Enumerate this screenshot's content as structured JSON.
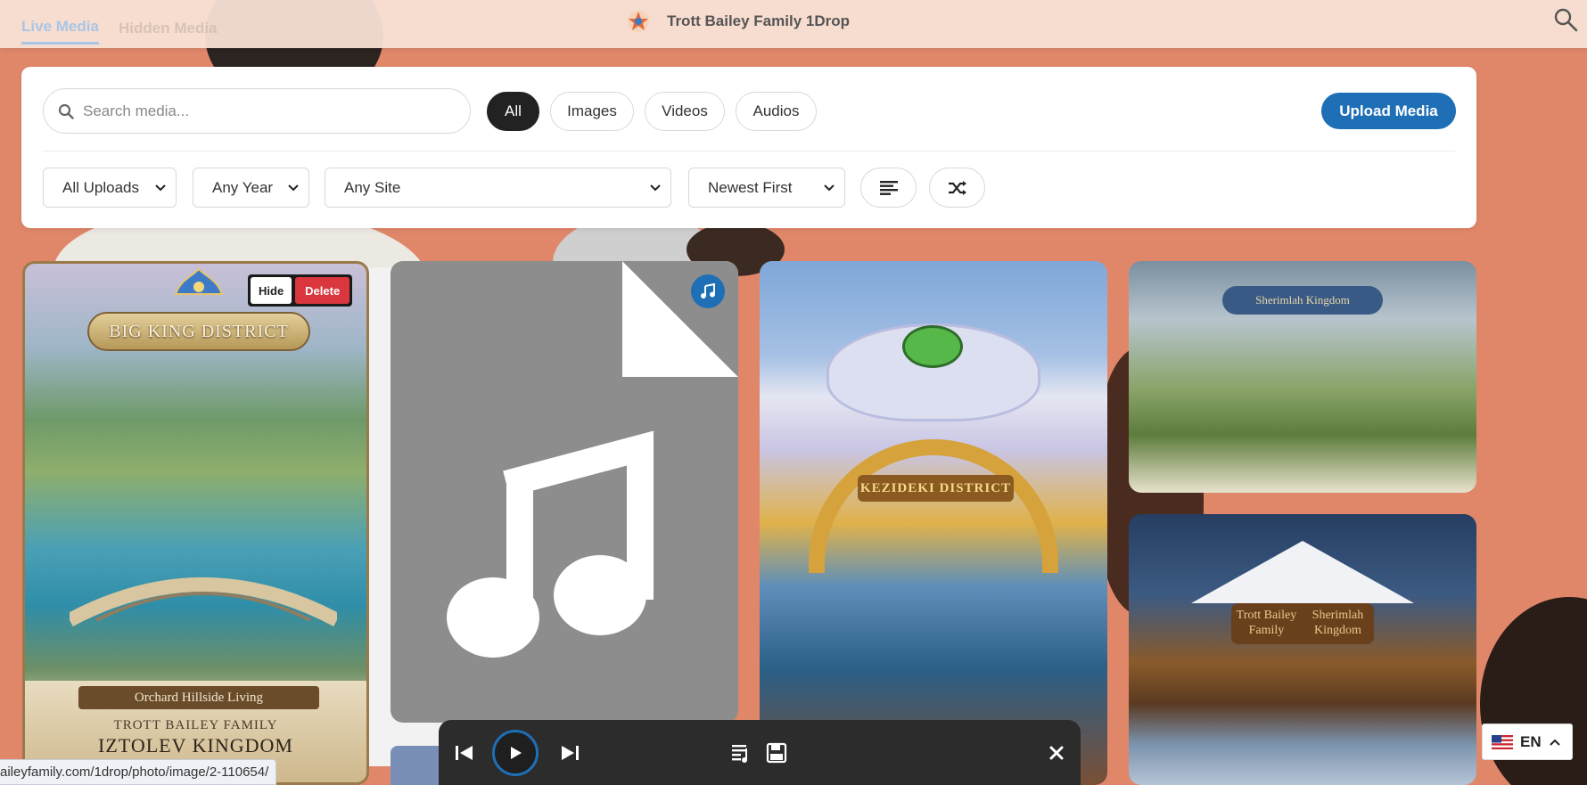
{
  "header": {
    "tabs": [
      {
        "label": "Live Media",
        "active": true
      },
      {
        "label": "Hidden Media",
        "active": false
      }
    ],
    "title": "Trott Bailey Family 1Drop"
  },
  "filters": {
    "search_placeholder": "Search media...",
    "type_chips": [
      {
        "label": "All",
        "active": true
      },
      {
        "label": "Images",
        "active": false
      },
      {
        "label": "Videos",
        "active": false
      },
      {
        "label": "Audios",
        "active": false
      }
    ],
    "upload_label": "Upload Media",
    "uploader_select": "All Uploads",
    "year_select": "Any Year",
    "site_select": "Any Site",
    "sort_select": "Newest First"
  },
  "cards": [
    {
      "type": "image",
      "banner": "BIG KING DISTRICT",
      "caption_top": "Orchard Hillside Living",
      "caption_family": "TROTT BAILEY FAMILY",
      "caption_kingdom": "IZTOLEV KINGDOM",
      "hide_label": "Hide",
      "delete_label": "Delete"
    },
    {
      "type": "audio",
      "badge_icon": "music-note-icon"
    },
    {
      "type": "image",
      "sign": "KEZIDEKI DISTRICT"
    },
    {
      "type": "image",
      "sign": "Sherimlah Kingdom"
    },
    {
      "type": "image",
      "sign_line1": "Trott Bailey Family",
      "sign_line2": "Sherimlah Kingdom"
    }
  ],
  "player": {
    "controls": [
      "previous-icon",
      "play-icon",
      "next-icon",
      "playlist-icon",
      "save-icon",
      "close-icon"
    ]
  },
  "status_url": "aileyfamily.com/1drop/photo/image/2-110654/",
  "language": {
    "code": "EN"
  },
  "colors": {
    "accent": "#1e6fb6",
    "delete": "#d9363e",
    "page_bg": "#e0876a",
    "topbar_bg": "#f8e2d6"
  }
}
